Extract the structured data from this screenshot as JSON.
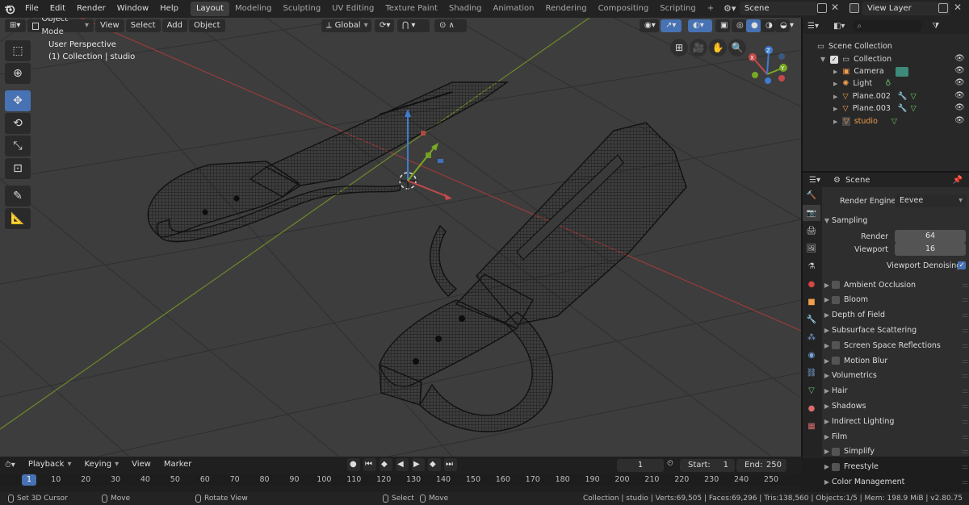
{
  "topbar": {
    "menus": [
      "File",
      "Edit",
      "Render",
      "Window",
      "Help"
    ],
    "workspaces": [
      "Layout",
      "Modeling",
      "Sculpting",
      "UV Editing",
      "Texture Paint",
      "Shading",
      "Animation",
      "Rendering",
      "Compositing",
      "Scripting"
    ],
    "add_tab_symbol": "+",
    "scene": "Scene",
    "view_layer": "View Layer"
  },
  "viewport": {
    "mode": "Object Mode",
    "menus": [
      "View",
      "Select",
      "Add",
      "Object"
    ],
    "transform_orientation": "Global",
    "perspective_label": "User Perspective",
    "collection_label": "(1) Collection | studio"
  },
  "outliner": {
    "search_placeholder": "",
    "scene_collection": "Scene Collection",
    "collection": "Collection",
    "items": [
      {
        "name": "Camera",
        "icon": "camera-object-icon"
      },
      {
        "name": "Light",
        "icon": "light-object-icon"
      },
      {
        "name": "Plane.002",
        "icon": "mesh-object-icon"
      },
      {
        "name": "Plane.003",
        "icon": "mesh-object-icon"
      },
      {
        "name": "studio",
        "icon": "mesh-object-icon"
      }
    ]
  },
  "properties": {
    "context": "Scene",
    "render_engine_label": "Render Engine",
    "render_engine": "Eevee",
    "sampling_label": "Sampling",
    "render_label": "Render",
    "render_samples": "64",
    "viewport_label": "Viewport",
    "viewport_samples": "16",
    "denoise_label": "Viewport Denoising",
    "sections": [
      {
        "label": "Ambient Occlusion",
        "checkbox": true
      },
      {
        "label": "Bloom",
        "checkbox": true
      },
      {
        "label": "Depth of Field",
        "checkbox": false
      },
      {
        "label": "Subsurface Scattering",
        "checkbox": false
      },
      {
        "label": "Screen Space Reflections",
        "checkbox": true
      },
      {
        "label": "Motion Blur",
        "checkbox": true
      },
      {
        "label": "Volumetrics",
        "checkbox": false
      },
      {
        "label": "Hair",
        "checkbox": false
      },
      {
        "label": "Shadows",
        "checkbox": false
      },
      {
        "label": "Indirect Lighting",
        "checkbox": false
      },
      {
        "label": "Film",
        "checkbox": false
      },
      {
        "label": "Simplify",
        "checkbox": true
      },
      {
        "label": "Freestyle",
        "checkbox": true
      },
      {
        "label": "Color Management",
        "checkbox": false
      }
    ]
  },
  "timeline": {
    "menus": [
      "Playback",
      "Keying",
      "View",
      "Marker"
    ],
    "current_frame": "1",
    "start_label": "Start:",
    "start": "1",
    "end_label": "End:",
    "end": "250",
    "ticks": [
      "1",
      "10",
      "20",
      "30",
      "40",
      "50",
      "60",
      "70",
      "80",
      "90",
      "100",
      "110",
      "120",
      "130",
      "140",
      "150",
      "160",
      "170",
      "180",
      "190",
      "200",
      "210",
      "220",
      "230",
      "240",
      "250"
    ]
  },
  "statusbar": {
    "left": [
      "Set 3D Cursor",
      "Move",
      "Rotate View",
      "Select",
      "Move"
    ],
    "stats": "Collection | studio | Verts:69,505 | Faces:69,296 | Tris:138,560 | Objects:1/5 | Mem: 198.9 MiB | v2.80.75"
  },
  "colors": {
    "accent": "#4772b3",
    "x_axis": "#c5494a",
    "y_axis": "#7aa823",
    "z_axis": "#3f7bd0",
    "orange_selected": "#f29e4c"
  }
}
